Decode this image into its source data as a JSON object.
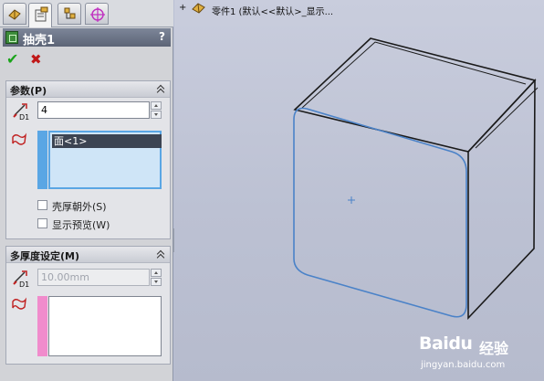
{
  "feature": {
    "title": "抽壳1",
    "help": "?"
  },
  "actions": {
    "ok_icon": "✔",
    "cancel_icon": "✖"
  },
  "params": {
    "title": "参数(P)",
    "thickness_value": "4",
    "thickness_icon_label": "D1",
    "faces": [
      "面<1>"
    ],
    "outward_label": "壳厚朝外(S)",
    "outward_checked": false,
    "preview_label": "显示预览(W)",
    "preview_checked": false
  },
  "multi_thickness": {
    "title": "多厚度设定(M)",
    "thickness_placeholder": "10.00mm",
    "thickness_icon_label": "D1",
    "faces": []
  },
  "viewport": {
    "tree_node_label": "零件1 (默认<<默认>_显示...",
    "tree_expander": "+"
  },
  "watermark": {
    "logo": "Baidu",
    "cn": "经验",
    "url": "jingyan.baidu.com"
  },
  "colors": {
    "title_bar": "#5c6476",
    "selection_active": "#5aa6e4",
    "multi_selection": "#f08ccc",
    "ok_green": "#1aa41a",
    "cancel_red": "#c01818",
    "edge_highlight": "#4a82c8"
  }
}
